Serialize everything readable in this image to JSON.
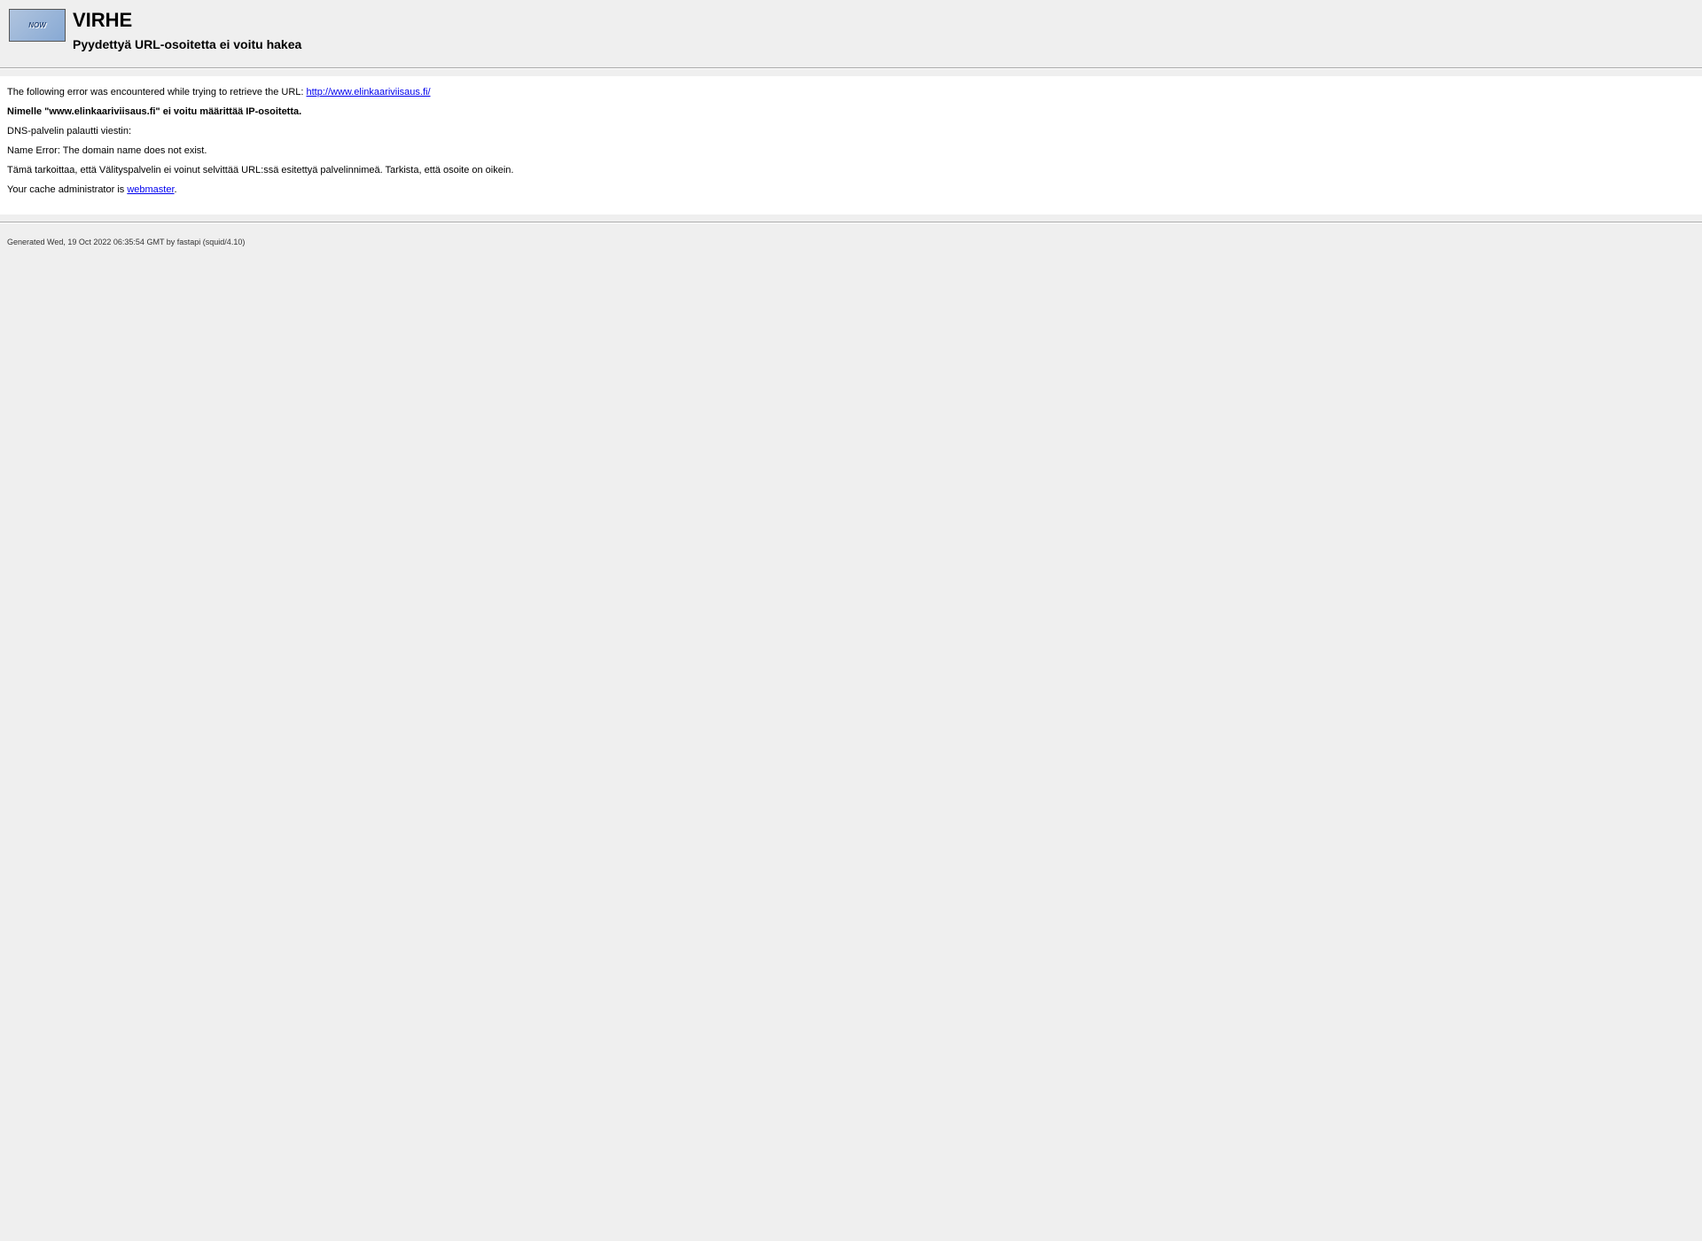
{
  "header": {
    "logo_text": "NOW",
    "title": "VIRHE",
    "subtitle": "Pyydettyä URL-osoitetta ei voitu hakea"
  },
  "content": {
    "intro_text": "The following error was encountered while trying to retrieve the URL: ",
    "url": "http://www.elinkaariviisaus.fi/",
    "bold_error": "Nimelle \"www.elinkaariviisaus.fi\" ei voitu määrittää IP-osoitetta.",
    "dns_text": "DNS-palvelin palautti viestin:",
    "dns_error": "Name Error: The domain name does not exist.",
    "explanation": "Tämä tarkoittaa, että Välityspalvelin ei voinut selvittää URL:ssä esitettyä palvelinnimeä. Tarkista, että osoite on oikein.",
    "admin_text": "Your cache administrator is ",
    "admin_link": "webmaster",
    "admin_period": "."
  },
  "footer": {
    "generated": "Generated Wed, 19 Oct 2022 06:35:54 GMT by fastapi (squid/4.10)"
  }
}
